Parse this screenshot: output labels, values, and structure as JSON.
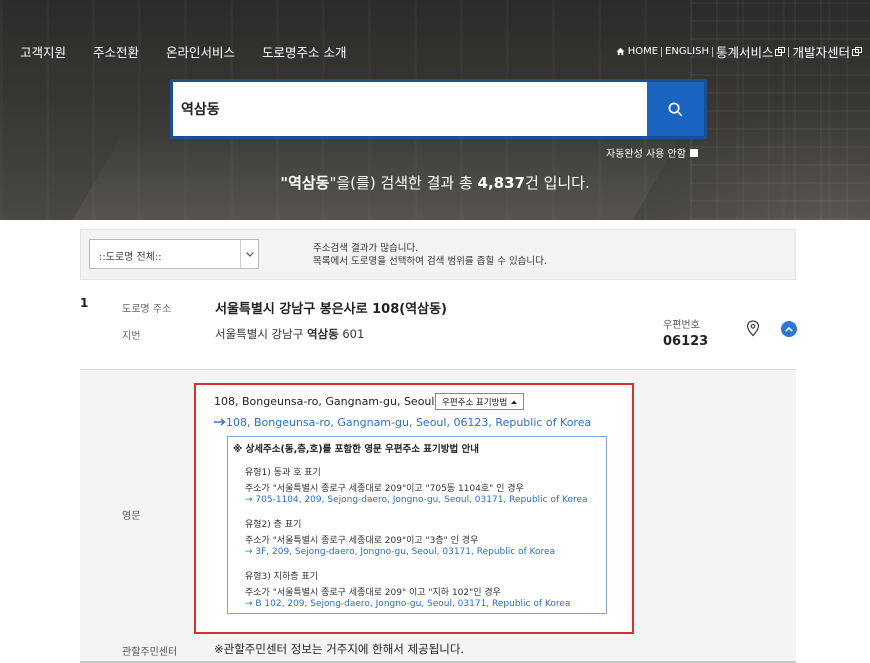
{
  "nav": {
    "items": [
      "고객지원",
      "주소전환",
      "온라인서비스",
      "도로명주소 소개"
    ]
  },
  "util": {
    "home": "HOME",
    "english": "ENGLISH",
    "stats": "통계서비스",
    "dev": "개발자센터"
  },
  "search": {
    "value": "역삼동",
    "autocomplete_label": "자동완성 사용 안함"
  },
  "result_summary": {
    "prefix": "\"",
    "keyword": "역삼동",
    "middle": "\"을(를) 검색한 결과 총 ",
    "count": "4,837",
    "suffix": "건 입니다."
  },
  "filter": {
    "select_value": "::도로명 전체::",
    "message_line1": "주소검색 결과가 많습니다.",
    "message_line2": "목록에서 도로명을 선택하여 검색 범위를 좁힐 수 있습니다."
  },
  "result": {
    "index": "1",
    "road_label": "도로명 주소",
    "road_address": "서울특별시 강남구 봉은사로 108(역삼동)",
    "jibun_label": "지번",
    "jibun_prefix": "서울특별시 강남구 ",
    "jibun_bold": "역삼동",
    "jibun_suffix": " 601",
    "zip_label": "우편번호",
    "zip": "06123"
  },
  "detail": {
    "english_label": "영문",
    "english_short": "108, Bongeunsa-ro, Gangnam-gu, Seoul",
    "postal_button": "우편주소 표기방법",
    "english_full": "108, Bongeunsa-ro, Gangnam-gu, Seoul, 06123, Republic of Korea",
    "guide_title": "※ 상세주소(동,층,호)를 포함한 영문 우편주소 표기방법 안내",
    "types": [
      {
        "title": "유형1) 동과 호 표기",
        "body": "주소가 \"서울특별시 종로구 세종대로 209\"이고 \"705동 1104호\" 인 경우",
        "example": "→ 705-1104, 209, Sejong-daero, Jongno-gu, Seoul, 03171, Republic of Korea"
      },
      {
        "title": "유형2) 층 표기",
        "body": "주소가 \"서울특별시 종로구 세종대로 209\"이고 \"3층\" 인 경우",
        "example": "→ 3F, 209, Sejong-daero, Jongno-gu, Seoul, 03171, Republic of Korea"
      },
      {
        "title": "유형3) 지하층 표기",
        "body": "주소가 \"서울특별시 종로구 세종대로 209\" 이고 \"지하 102\"인 경우",
        "example": "→ B 102, 209, Sejong-daero, Jongno-gu, Seoul, 03171, Republic of Korea"
      }
    ],
    "center_label": "관할주민센터",
    "center_message": "※관할주민센터 정보는 거주지에 한해서 제공됩니다."
  },
  "colors": {
    "accent": "#1a65c0",
    "highlight_border": "#d63131",
    "link": "#2c6fc2"
  }
}
